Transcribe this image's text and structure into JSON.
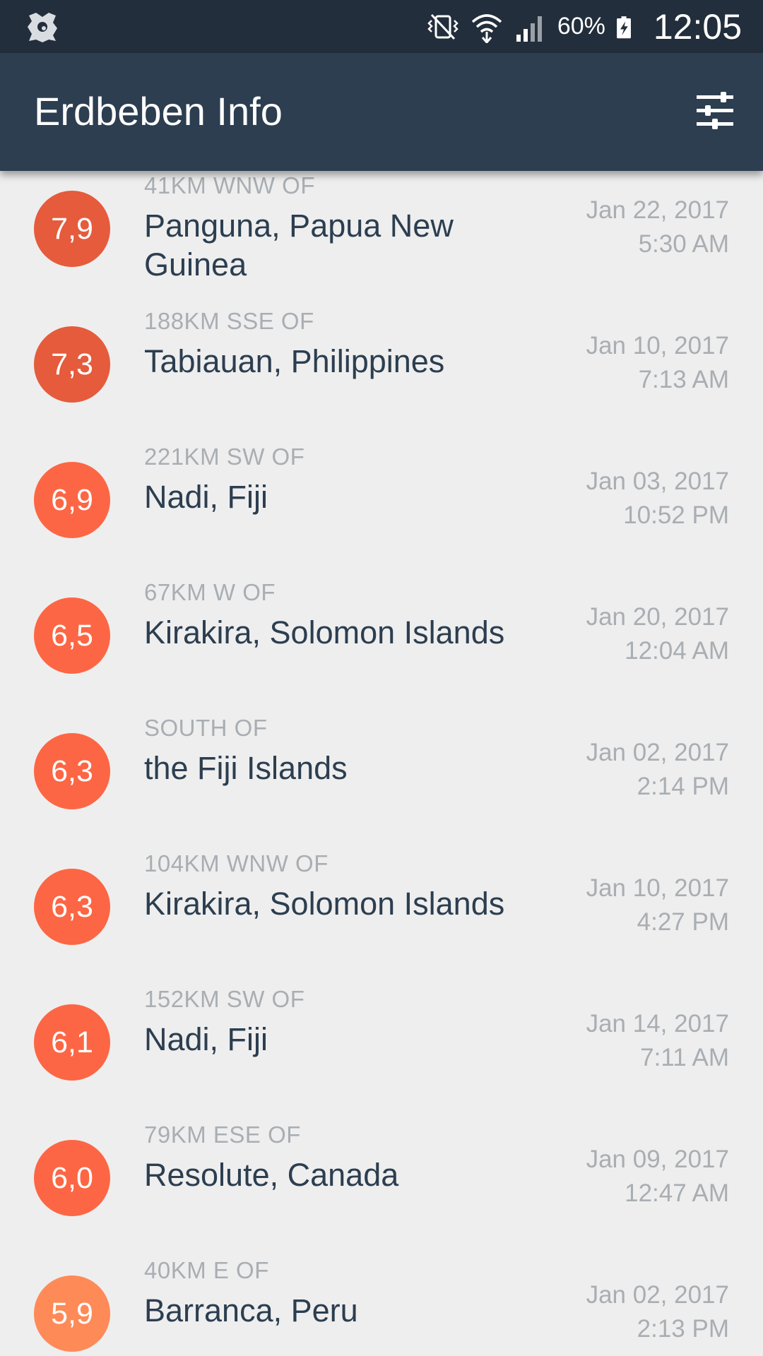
{
  "status_bar": {
    "battery": "60%",
    "time": "12:05"
  },
  "app_bar": {
    "title": "Erdbeben Info",
    "filter_icon": "sliders-icon"
  },
  "colors": {
    "status_bar_bg": "#222e3b",
    "app_bar_bg": "#2c3e50",
    "list_bg": "#eeeeee",
    "place_text": "#2c3e50",
    "secondary_text": "#a9aeb3"
  },
  "quakes": [
    {
      "magnitude": "7,9",
      "offset": "41KM WNW OF",
      "place": "Panguna, Papua New Guinea",
      "date": "Jan 22, 2017",
      "time": "5:30 AM",
      "color": "#e55b3c"
    },
    {
      "magnitude": "7,3",
      "offset": "188KM SSE OF",
      "place": "Tabiauan, Philippines",
      "date": "Jan 10, 2017",
      "time": "7:13 AM",
      "color": "#e55b3c"
    },
    {
      "magnitude": "6,9",
      "offset": "221KM SW OF",
      "place": "Nadi, Fiji",
      "date": "Jan 03, 2017",
      "time": "10:52 PM",
      "color": "#fd6644"
    },
    {
      "magnitude": "6,5",
      "offset": "67KM W OF",
      "place": "Kirakira, Solomon Islands",
      "date": "Jan 20, 2017",
      "time": "12:04 AM",
      "color": "#fd6644"
    },
    {
      "magnitude": "6,3",
      "offset": "SOUTH OF",
      "place": "the Fiji Islands",
      "date": "Jan 02, 2017",
      "time": "2:14 PM",
      "color": "#fd6644"
    },
    {
      "magnitude": "6,3",
      "offset": "104KM WNW OF",
      "place": "Kirakira, Solomon Islands",
      "date": "Jan 10, 2017",
      "time": "4:27 PM",
      "color": "#fd6644"
    },
    {
      "magnitude": "6,1",
      "offset": "152KM SW OF",
      "place": "Nadi, Fiji",
      "date": "Jan 14, 2017",
      "time": "7:11 AM",
      "color": "#fd6644"
    },
    {
      "magnitude": "6,0",
      "offset": "79KM ESE OF",
      "place": "Resolute, Canada",
      "date": "Jan 09, 2017",
      "time": "12:47 AM",
      "color": "#fd6644"
    },
    {
      "magnitude": "5,9",
      "offset": "40KM E OF",
      "place": "Barranca, Peru",
      "date": "Jan 02, 2017",
      "time": "2:13 PM",
      "color": "#fe8a58"
    }
  ]
}
